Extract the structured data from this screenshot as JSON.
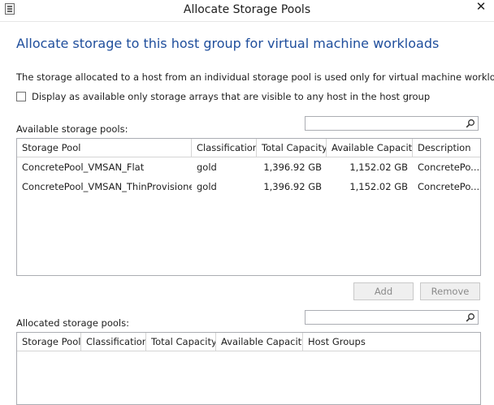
{
  "window": {
    "title": "Allocate Storage Pools",
    "close_glyph": "✕"
  },
  "heading": "Allocate storage to this host group for virtual machine workloads",
  "description": "The storage allocated to a host from an individual storage pool is used only for virtual machine workloads.",
  "visible_only_option": {
    "label": "Display as available only storage arrays that are visible to any host in the host group",
    "checked": false
  },
  "available": {
    "label": "Available storage pools:",
    "search_value": "",
    "columns": [
      "Storage Pool",
      "Classification",
      "Total Capacity",
      "Available Capacity",
      "Description"
    ],
    "rows": [
      [
        "ConcretePool_VMSAN_Flat",
        "gold",
        "1,396.92 GB",
        "1,152.02 GB",
        "ConcretePo..."
      ],
      [
        "ConcretePool_VMSAN_ThinProvisioned",
        "gold",
        "1,396.92 GB",
        "1,152.02 GB",
        "ConcretePo..."
      ]
    ]
  },
  "buttons": {
    "add": "Add",
    "remove": "Remove"
  },
  "allocated": {
    "label": "Allocated storage pools:",
    "search_value": "",
    "columns": [
      "Storage Pool",
      "Classification",
      "Total Capacity",
      "Available Capacity",
      "Host Groups"
    ],
    "rows": []
  },
  "icons": {
    "app": "list-window-icon",
    "search": "magnifier-icon",
    "close": "close-icon"
  },
  "colors": {
    "heading": "#1f4e9c",
    "grid_border": "#abadb3",
    "disabled_text": "#8a8a8a"
  }
}
